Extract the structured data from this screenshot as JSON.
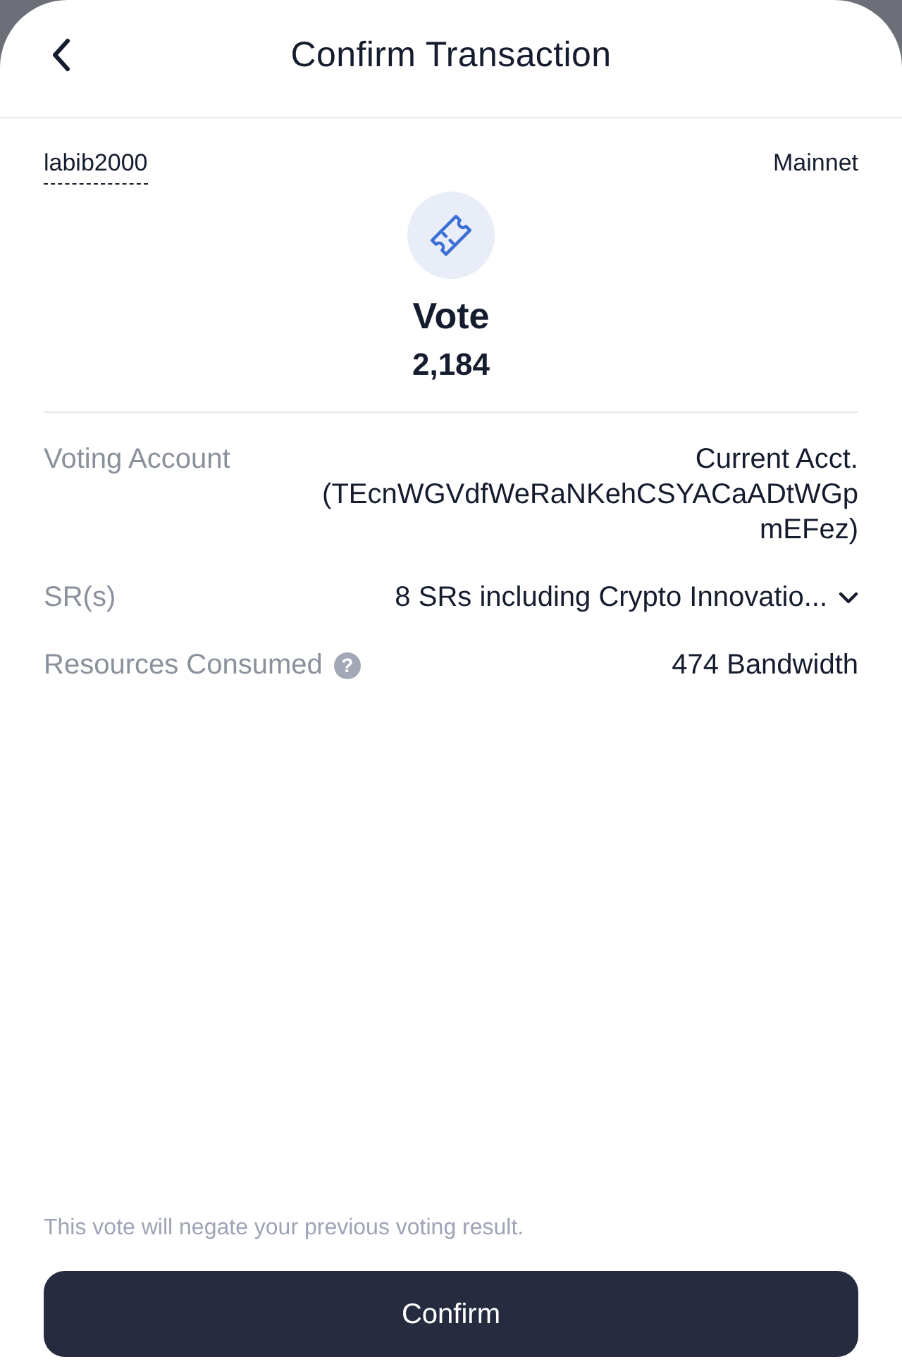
{
  "header": {
    "title": "Confirm Transaction"
  },
  "account": {
    "name": "labib2000",
    "network": "Mainnet"
  },
  "transaction": {
    "type": "Vote",
    "amount": "2,184"
  },
  "details": [
    {
      "label": "Voting Account",
      "value": "Current Acct. (TEcnWGVdfWeRaNKehCSYACaADtWGpmEFez)"
    },
    {
      "label": "SR(s)",
      "value": "8 SRs including Crypto Innovatio...",
      "expanded": false
    },
    {
      "label": "Resources Consumed",
      "help_icon": "?",
      "value": "474 Bandwidth"
    }
  ],
  "notice": "This vote will negate your previous voting result.",
  "confirm_button": "Confirm"
}
